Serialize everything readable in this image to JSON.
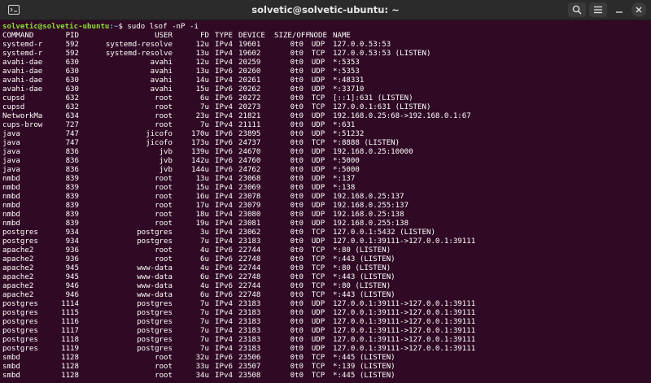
{
  "window": {
    "title": "solvetic@solvetic-ubuntu: ~"
  },
  "icons": {
    "new_tab": "terminal-add-icon",
    "search": "search-icon",
    "menu": "hamburger-menu-icon",
    "minimize": "minimize-icon",
    "close": "close-icon"
  },
  "prompt": {
    "user_host": "solvetic@solvetic-ubuntu",
    "path": ":~",
    "symbol": "$",
    "command": " sudo lsof -nP -i"
  },
  "header": {
    "command": "COMMAND",
    "pid": "PID",
    "user": "USER",
    "fd": "FD",
    "type": "TYPE",
    "device": "DEVICE",
    "size": "SIZE/OFF",
    "node": "NODE",
    "name": "NAME"
  },
  "rows": [
    {
      "command": "systemd-r",
      "pid": "592",
      "user": "systemd-resolve",
      "fd": "12u",
      "type": "IPv4",
      "device": "19601",
      "size": "0t0",
      "node": "UDP",
      "name": "127.0.0.53:53"
    },
    {
      "command": "systemd-r",
      "pid": "592",
      "user": "systemd-resolve",
      "fd": "13u",
      "type": "IPv4",
      "device": "19602",
      "size": "0t0",
      "node": "TCP",
      "name": "127.0.0.53:53 (LISTEN)"
    },
    {
      "command": "avahi-dae",
      "pid": "630",
      "user": "avahi",
      "fd": "12u",
      "type": "IPv4",
      "device": "20259",
      "size": "0t0",
      "node": "UDP",
      "name": "*:5353"
    },
    {
      "command": "avahi-dae",
      "pid": "630",
      "user": "avahi",
      "fd": "13u",
      "type": "IPv6",
      "device": "20260",
      "size": "0t0",
      "node": "UDP",
      "name": "*:5353"
    },
    {
      "command": "avahi-dae",
      "pid": "630",
      "user": "avahi",
      "fd": "14u",
      "type": "IPv4",
      "device": "20261",
      "size": "0t0",
      "node": "UDP",
      "name": "*:48331"
    },
    {
      "command": "avahi-dae",
      "pid": "630",
      "user": "avahi",
      "fd": "15u",
      "type": "IPv6",
      "device": "20262",
      "size": "0t0",
      "node": "UDP",
      "name": "*:33710"
    },
    {
      "command": "cupsd",
      "pid": "632",
      "user": "root",
      "fd": "6u",
      "type": "IPv6",
      "device": "20272",
      "size": "0t0",
      "node": "TCP",
      "name": "[::1]:631 (LISTEN)"
    },
    {
      "command": "cupsd",
      "pid": "632",
      "user": "root",
      "fd": "7u",
      "type": "IPv4",
      "device": "20273",
      "size": "0t0",
      "node": "TCP",
      "name": "127.0.0.1:631 (LISTEN)"
    },
    {
      "command": "NetworkMa",
      "pid": "634",
      "user": "root",
      "fd": "23u",
      "type": "IPv4",
      "device": "21821",
      "size": "0t0",
      "node": "UDP",
      "name": "192.168.0.25:68->192.168.0.1:67"
    },
    {
      "command": "cups-brow",
      "pid": "727",
      "user": "root",
      "fd": "7u",
      "type": "IPv4",
      "device": "21111",
      "size": "0t0",
      "node": "UDP",
      "name": "*:631"
    },
    {
      "command": "java",
      "pid": "747",
      "user": "jicofo",
      "fd": "170u",
      "type": "IPv6",
      "device": "23895",
      "size": "0t0",
      "node": "UDP",
      "name": "*:51232"
    },
    {
      "command": "java",
      "pid": "747",
      "user": "jicofo",
      "fd": "173u",
      "type": "IPv6",
      "device": "24737",
      "size": "0t0",
      "node": "TCP",
      "name": "*:8888 (LISTEN)"
    },
    {
      "command": "java",
      "pid": "836",
      "user": "jvb",
      "fd": "139u",
      "type": "IPv6",
      "device": "24670",
      "size": "0t0",
      "node": "UDP",
      "name": "192.168.0.25:10000"
    },
    {
      "command": "java",
      "pid": "836",
      "user": "jvb",
      "fd": "142u",
      "type": "IPv6",
      "device": "24760",
      "size": "0t0",
      "node": "UDP",
      "name": "*:5000"
    },
    {
      "command": "java",
      "pid": "836",
      "user": "jvb",
      "fd": "144u",
      "type": "IPv6",
      "device": "24762",
      "size": "0t0",
      "node": "UDP",
      "name": "*:5000"
    },
    {
      "command": "nmbd",
      "pid": "839",
      "user": "root",
      "fd": "13u",
      "type": "IPv4",
      "device": "23068",
      "size": "0t0",
      "node": "UDP",
      "name": "*:137"
    },
    {
      "command": "nmbd",
      "pid": "839",
      "user": "root",
      "fd": "15u",
      "type": "IPv4",
      "device": "23069",
      "size": "0t0",
      "node": "UDP",
      "name": "*:138"
    },
    {
      "command": "nmbd",
      "pid": "839",
      "user": "root",
      "fd": "16u",
      "type": "IPv4",
      "device": "23078",
      "size": "0t0",
      "node": "UDP",
      "name": "192.168.0.25:137"
    },
    {
      "command": "nmbd",
      "pid": "839",
      "user": "root",
      "fd": "17u",
      "type": "IPv4",
      "device": "23079",
      "size": "0t0",
      "node": "UDP",
      "name": "192.168.0.255:137"
    },
    {
      "command": "nmbd",
      "pid": "839",
      "user": "root",
      "fd": "18u",
      "type": "IPv4",
      "device": "23080",
      "size": "0t0",
      "node": "UDP",
      "name": "192.168.0.25:138"
    },
    {
      "command": "nmbd",
      "pid": "839",
      "user": "root",
      "fd": "19u",
      "type": "IPv4",
      "device": "23081",
      "size": "0t0",
      "node": "UDP",
      "name": "192.168.0.255:138"
    },
    {
      "command": "postgres",
      "pid": "934",
      "user": "postgres",
      "fd": "3u",
      "type": "IPv4",
      "device": "23062",
      "size": "0t0",
      "node": "TCP",
      "name": "127.0.0.1:5432 (LISTEN)"
    },
    {
      "command": "postgres",
      "pid": "934",
      "user": "postgres",
      "fd": "7u",
      "type": "IPv4",
      "device": "23183",
      "size": "0t0",
      "node": "UDP",
      "name": "127.0.0.1:39111->127.0.0.1:39111"
    },
    {
      "command": "apache2",
      "pid": "936",
      "user": "root",
      "fd": "4u",
      "type": "IPv6",
      "device": "22744",
      "size": "0t0",
      "node": "TCP",
      "name": "*:80 (LISTEN)"
    },
    {
      "command": "apache2",
      "pid": "936",
      "user": "root",
      "fd": "6u",
      "type": "IPv6",
      "device": "22748",
      "size": "0t0",
      "node": "TCP",
      "name": "*:443 (LISTEN)"
    },
    {
      "command": "apache2",
      "pid": "945",
      "user": "www-data",
      "fd": "4u",
      "type": "IPv6",
      "device": "22744",
      "size": "0t0",
      "node": "TCP",
      "name": "*:80 (LISTEN)"
    },
    {
      "command": "apache2",
      "pid": "945",
      "user": "www-data",
      "fd": "6u",
      "type": "IPv6",
      "device": "22748",
      "size": "0t0",
      "node": "TCP",
      "name": "*:443 (LISTEN)"
    },
    {
      "command": "apache2",
      "pid": "946",
      "user": "www-data",
      "fd": "4u",
      "type": "IPv6",
      "device": "22744",
      "size": "0t0",
      "node": "TCP",
      "name": "*:80 (LISTEN)"
    },
    {
      "command": "apache2",
      "pid": "946",
      "user": "www-data",
      "fd": "6u",
      "type": "IPv6",
      "device": "22748",
      "size": "0t0",
      "node": "TCP",
      "name": "*:443 (LISTEN)"
    },
    {
      "command": "postgres",
      "pid": "1114",
      "user": "postgres",
      "fd": "7u",
      "type": "IPv4",
      "device": "23183",
      "size": "0t0",
      "node": "UDP",
      "name": "127.0.0.1:39111->127.0.0.1:39111"
    },
    {
      "command": "postgres",
      "pid": "1115",
      "user": "postgres",
      "fd": "7u",
      "type": "IPv4",
      "device": "23183",
      "size": "0t0",
      "node": "UDP",
      "name": "127.0.0.1:39111->127.0.0.1:39111"
    },
    {
      "command": "postgres",
      "pid": "1116",
      "user": "postgres",
      "fd": "7u",
      "type": "IPv4",
      "device": "23183",
      "size": "0t0",
      "node": "UDP",
      "name": "127.0.0.1:39111->127.0.0.1:39111"
    },
    {
      "command": "postgres",
      "pid": "1117",
      "user": "postgres",
      "fd": "7u",
      "type": "IPv4",
      "device": "23183",
      "size": "0t0",
      "node": "UDP",
      "name": "127.0.0.1:39111->127.0.0.1:39111"
    },
    {
      "command": "postgres",
      "pid": "1118",
      "user": "postgres",
      "fd": "7u",
      "type": "IPv4",
      "device": "23183",
      "size": "0t0",
      "node": "UDP",
      "name": "127.0.0.1:39111->127.0.0.1:39111"
    },
    {
      "command": "postgres",
      "pid": "1119",
      "user": "postgres",
      "fd": "7u",
      "type": "IPv4",
      "device": "23183",
      "size": "0t0",
      "node": "UDP",
      "name": "127.0.0.1:39111->127.0.0.1:39111"
    },
    {
      "command": "smbd",
      "pid": "1128",
      "user": "root",
      "fd": "32u",
      "type": "IPv6",
      "device": "23506",
      "size": "0t0",
      "node": "TCP",
      "name": "*:445 (LISTEN)"
    },
    {
      "command": "smbd",
      "pid": "1128",
      "user": "root",
      "fd": "33u",
      "type": "IPv6",
      "device": "23507",
      "size": "0t0",
      "node": "TCP",
      "name": "*:139 (LISTEN)"
    },
    {
      "command": "smbd",
      "pid": "1128",
      "user": "root",
      "fd": "34u",
      "type": "IPv4",
      "device": "23508",
      "size": "0t0",
      "node": "TCP",
      "name": "*:445 (LISTEN)"
    }
  ],
  "colors": {
    "background": "#300a24",
    "titlebar": "#2b2b2b",
    "prompt_user": "#8ae234",
    "prompt_path": "#729fcf",
    "text": "#ffffff"
  }
}
